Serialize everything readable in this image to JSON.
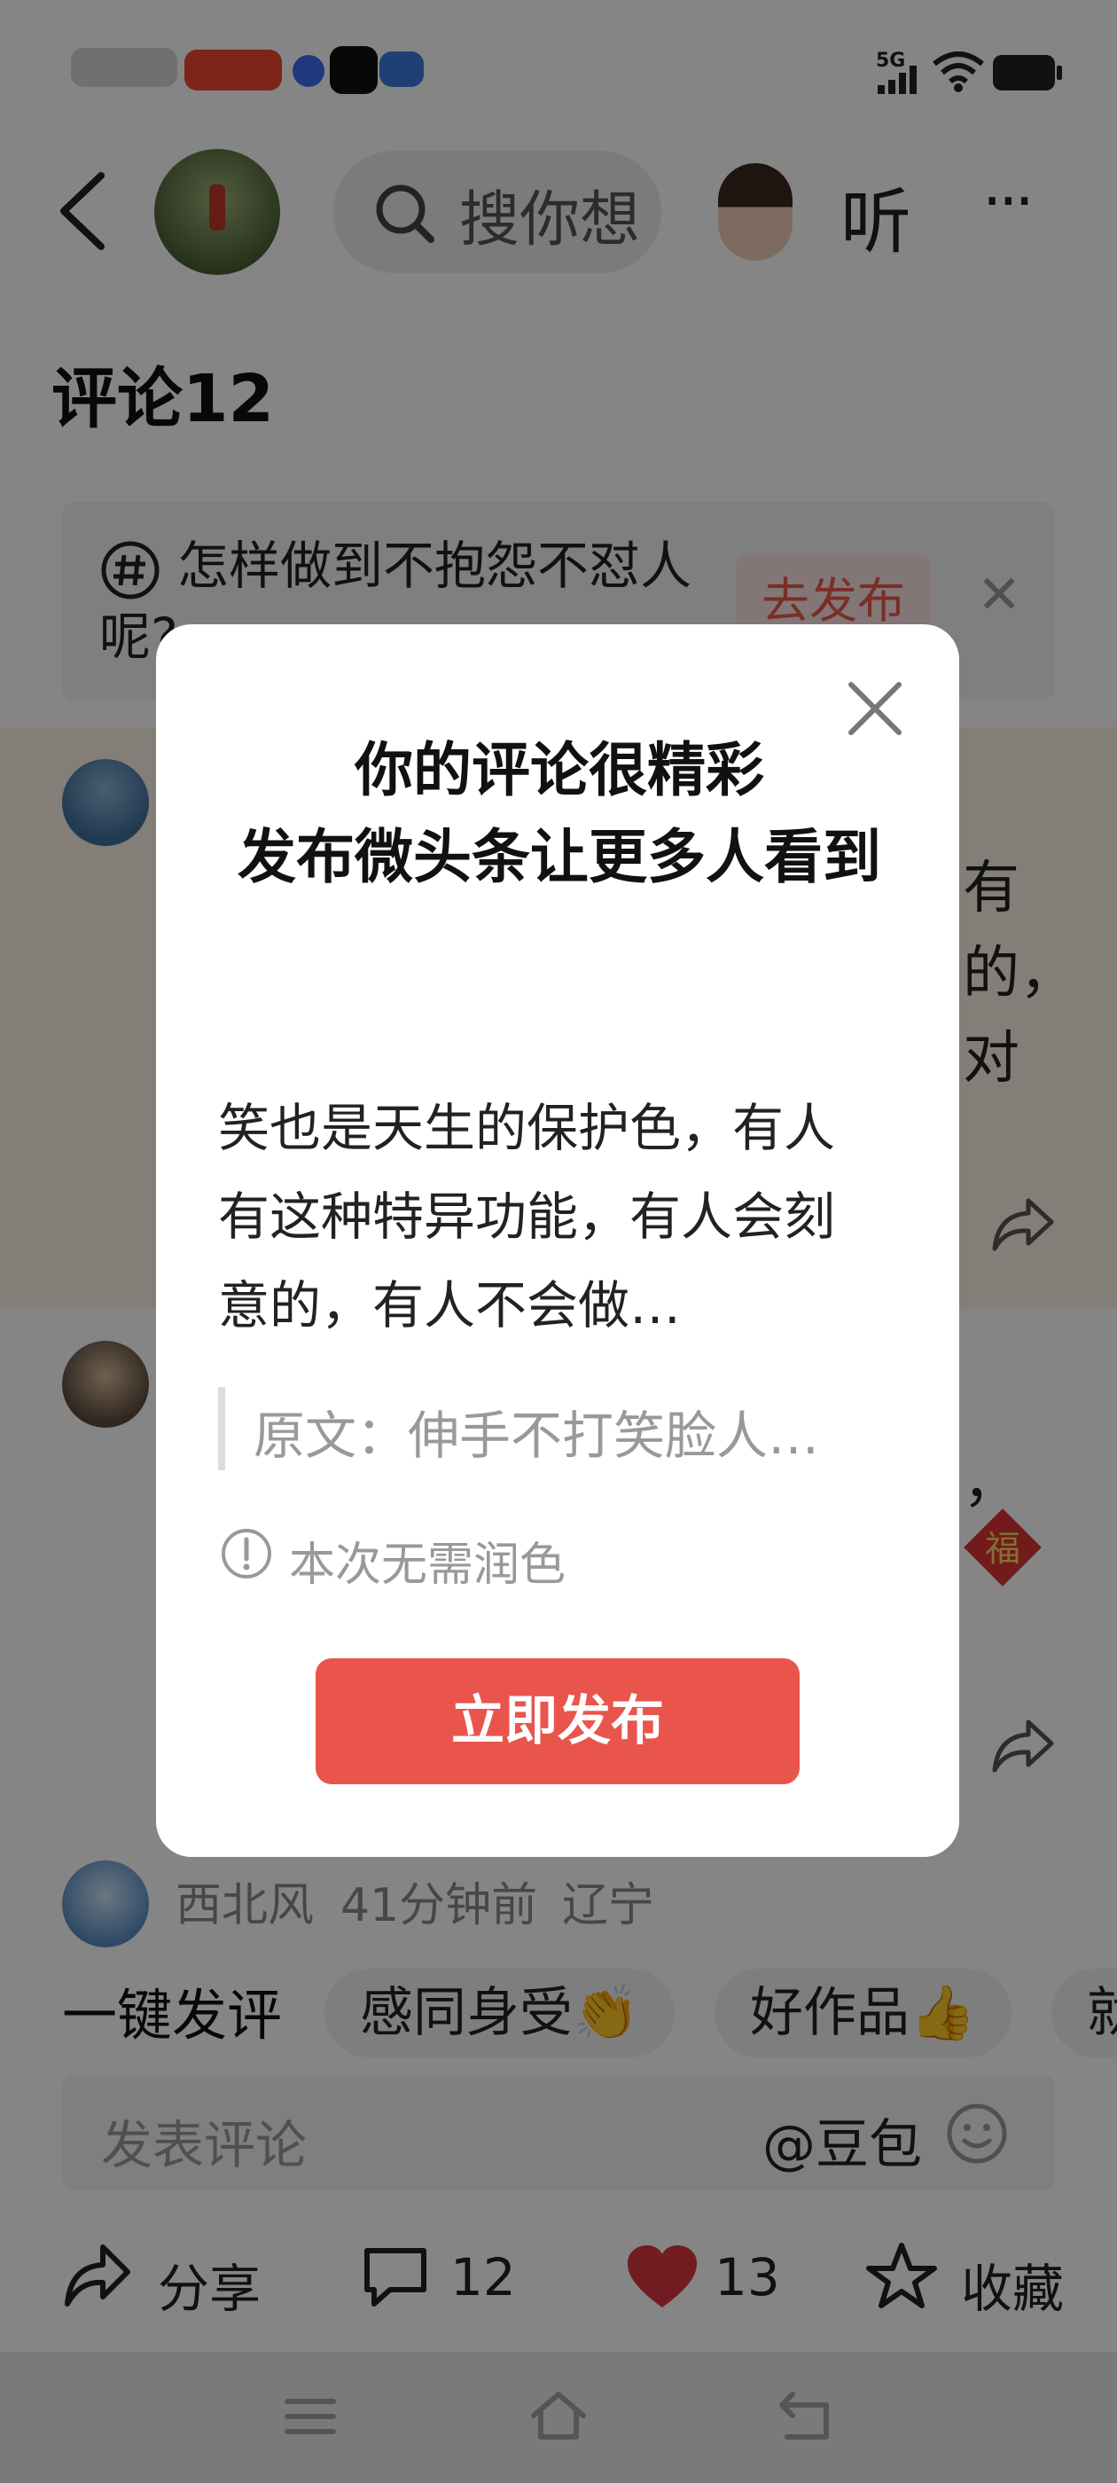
{
  "status_bar": {
    "network": "5G",
    "icons": [
      "signal-icon",
      "wifi-icon",
      "battery-icon"
    ]
  },
  "nav": {
    "search_placeholder": "搜你想",
    "listen_label": "听",
    "more_label": "···"
  },
  "comments": {
    "title": "评论12",
    "topic": {
      "text": "怎样做到不抱怨不怼人呢?",
      "button": "去发布"
    },
    "comment1_fragments": [
      "有",
      "的，",
      "对"
    ],
    "comment2_fragment": "，",
    "fu_badge": "福",
    "comment3": {
      "user": "西北风",
      "time": "41分钟前",
      "location": "辽宁"
    }
  },
  "quick_comment": {
    "label": "一键发评",
    "chips": [
      "感同身受👏",
      "好作品👍",
      "就"
    ]
  },
  "input": {
    "placeholder": "发表评论",
    "mention": "@豆包"
  },
  "bottom_bar": {
    "share_label": "分享",
    "comment_count": "12",
    "like_count": "13",
    "collect_label": "收藏"
  },
  "dialog": {
    "title_line1": "你的评论很精彩",
    "title_line2": "发布微头条让更多人看到",
    "body": "笑也是天生的保护色，有人有这种特异功能，有人会刻意的，有人不会做…",
    "quote": "原文：伸手不打笑脸人…",
    "hint": "本次无需润色",
    "publish_button": "立即发布"
  },
  "colors": {
    "accent": "#e9554c",
    "tag_bg": "#fbe3e2",
    "highlight_bg": "#fbf2e6",
    "like": "#d9363e"
  }
}
